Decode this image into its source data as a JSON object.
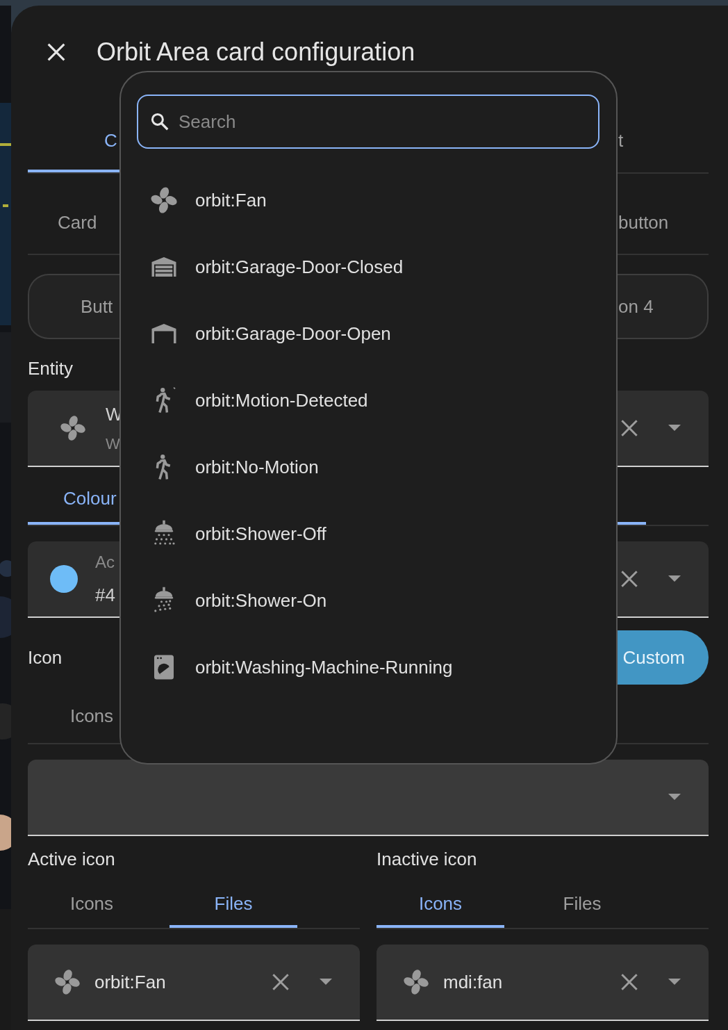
{
  "dialog": {
    "title": "Orbit Area card configuration"
  },
  "top_tabs": [
    {
      "label": "C",
      "selected": true
    },
    {
      "label": "t",
      "selected": false
    }
  ],
  "sub_tabs": [
    {
      "label": "Card"
    },
    {
      "label": "button"
    }
  ],
  "button_segments": [
    {
      "label": "Butt"
    },
    {
      "label": "on 4"
    }
  ],
  "entity": {
    "label": "Entity",
    "name": "W",
    "entity_id": "W"
  },
  "colour_tab": {
    "label": "Colour",
    "selected": true
  },
  "colour_field": {
    "color": "#6ebcf7",
    "label": "Ac",
    "value": "#4"
  },
  "icon_section": {
    "label": "Icon",
    "mode_button": "Custom",
    "tab": {
      "label": "Icons",
      "selected": false
    }
  },
  "active_icon": {
    "label": "Active icon",
    "tabs": [
      {
        "label": "Icons",
        "selected": false
      },
      {
        "label": "Files",
        "selected": true
      }
    ],
    "value": "orbit:Fan"
  },
  "inactive_icon": {
    "label": "Inactive icon",
    "tabs": [
      {
        "label": "Icons",
        "selected": true
      },
      {
        "label": "Files",
        "selected": false
      }
    ],
    "value": "mdi:fan"
  },
  "icon_picker": {
    "search": {
      "placeholder": "Search"
    },
    "options": [
      {
        "label": "orbit:Fan",
        "kind": "fan"
      },
      {
        "label": "orbit:Garage-Door-Closed",
        "kind": "garage-closed"
      },
      {
        "label": "orbit:Garage-Door-Open",
        "kind": "garage-open"
      },
      {
        "label": "orbit:Motion-Detected",
        "kind": "motion"
      },
      {
        "label": "orbit:No-Motion",
        "kind": "walk"
      },
      {
        "label": "orbit:Shower-Off",
        "kind": "shower-off"
      },
      {
        "label": "orbit:Shower-On",
        "kind": "shower-on"
      },
      {
        "label": "orbit:Washing-Machine-Running",
        "kind": "washer"
      }
    ]
  }
}
